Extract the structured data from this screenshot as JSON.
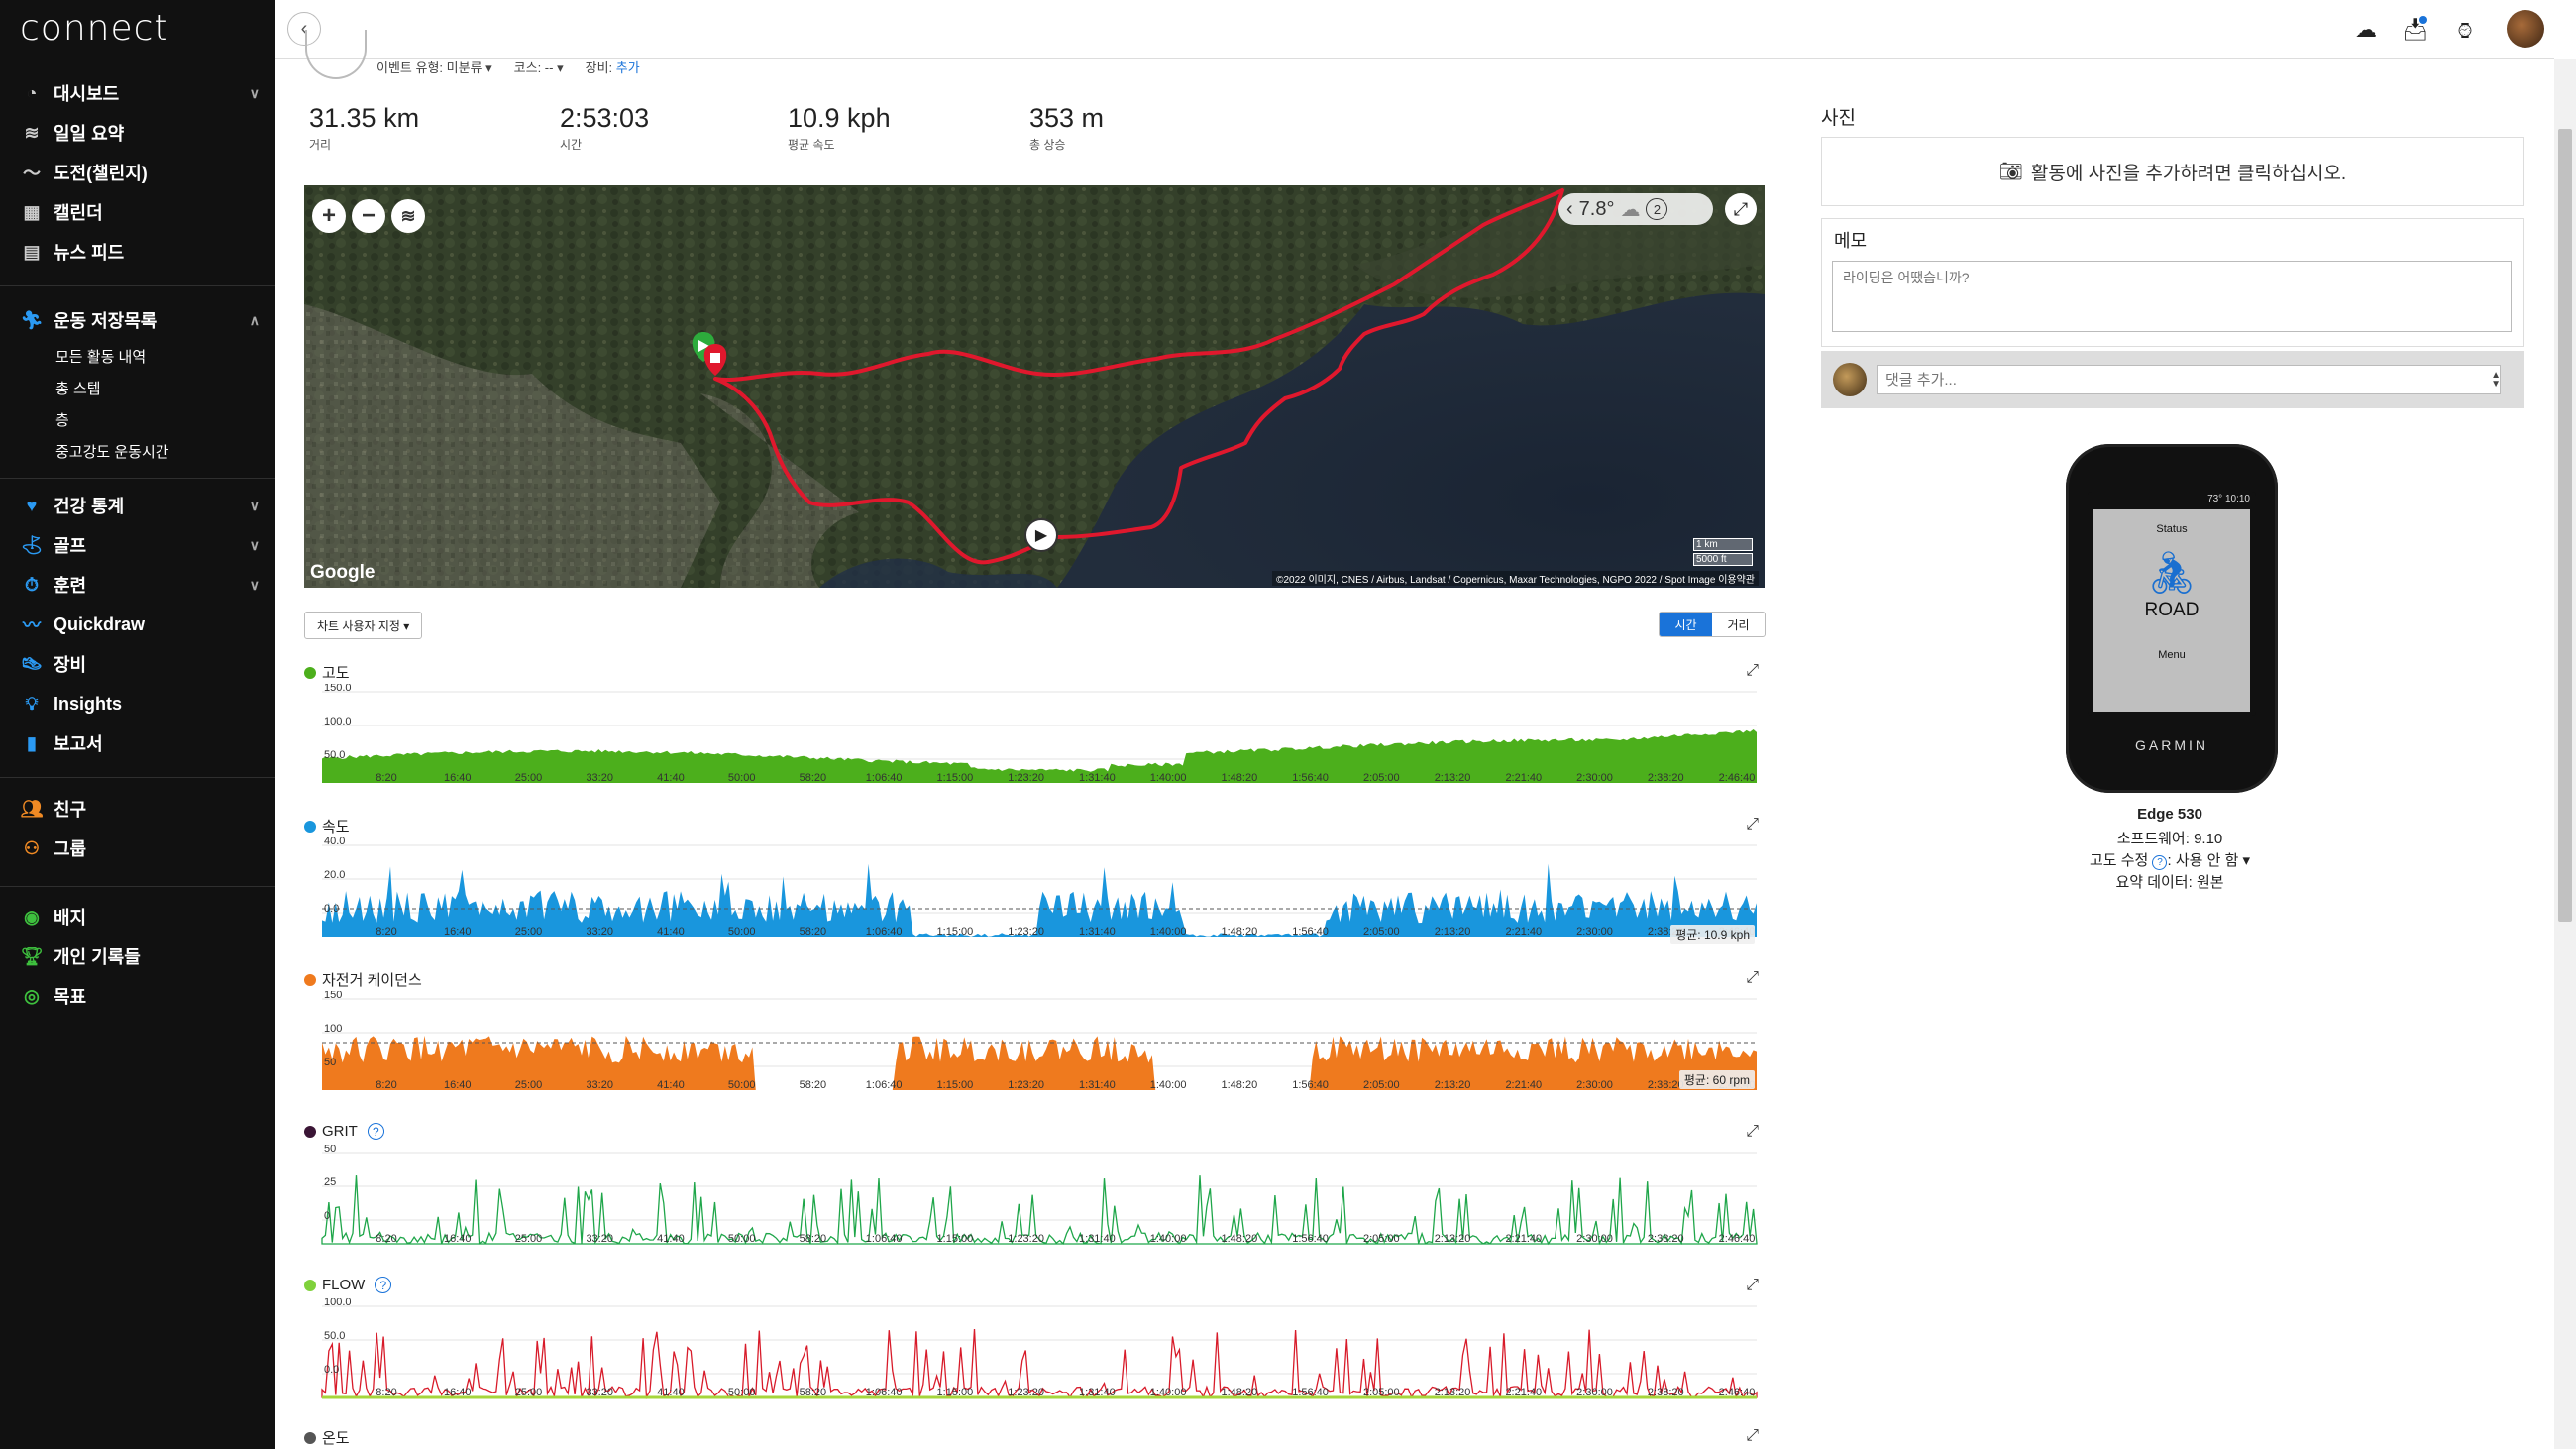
{
  "app": {
    "logo": "connect"
  },
  "sidebar": {
    "main": [
      {
        "label": "대시보드",
        "icon": "dashboard-icon",
        "chevron": "∨"
      },
      {
        "label": "일일 요약",
        "icon": "layers-icon"
      },
      {
        "label": "도전(챌린지)",
        "icon": "challenge-icon"
      },
      {
        "label": "캘린더",
        "icon": "calendar-icon"
      },
      {
        "label": "뉴스 피드",
        "icon": "newsfeed-icon"
      }
    ],
    "activities": {
      "label": "운동 저장목록",
      "icon": "runner-icon",
      "chevron": "∧",
      "sub": [
        "모든 활동 내역",
        "총 스텝",
        "층",
        "중고강도 운동시간"
      ]
    },
    "more": [
      {
        "label": "건강 통계",
        "icon": "heart-icon",
        "chevron": "∨"
      },
      {
        "label": "골프",
        "icon": "golf-icon",
        "chevron": "∨"
      },
      {
        "label": "훈련",
        "icon": "stopwatch-icon",
        "chevron": "∨"
      },
      {
        "label": "Quickdraw",
        "icon": "quickdraw-icon"
      },
      {
        "label": "장비",
        "icon": "shoe-icon"
      },
      {
        "label": "Insights",
        "icon": "bulb-icon"
      },
      {
        "label": "보고서",
        "icon": "report-icon"
      }
    ],
    "social": [
      {
        "label": "친구",
        "icon": "friends-icon"
      },
      {
        "label": "그룹",
        "icon": "group-icon"
      }
    ],
    "achievements": [
      {
        "label": "배지",
        "icon": "badge-icon"
      },
      {
        "label": "개인 기록들",
        "icon": "trophy-icon"
      },
      {
        "label": "목표",
        "icon": "target-icon"
      }
    ]
  },
  "header": {
    "meta": {
      "event_type": "이벤트 유형: 미분류 ▾",
      "course": "코스: -- ▾",
      "gear_prefix": "장비: ",
      "gear_link": "추가"
    }
  },
  "stats": [
    {
      "value": "31.35 km",
      "label": "거리"
    },
    {
      "value": "2:53:03",
      "label": "시간"
    },
    {
      "value": "10.9 kph",
      "label": "평균 속도"
    },
    {
      "value": "353 m",
      "label": "총 상승"
    }
  ],
  "map": {
    "weather_temp": "7.8°",
    "weather_num": "2",
    "google": "Google",
    "attribution": "©2022 이미지, CNES / Airbus, Landsat / Copernicus, Maxar Technologies, NGPO 2022 / Spot Image   이용약관",
    "scale_km": "1 km",
    "scale_ft": "5000 ft"
  },
  "chart_controls": {
    "customize": "차트 사용자 지정 ▾",
    "toggle": [
      "시간",
      "거리"
    ]
  },
  "x_ticks": [
    "8:20",
    "16:40",
    "25:00",
    "33:20",
    "41:40",
    "50:00",
    "58:20",
    "1:06:40",
    "1:15:00",
    "1:23:20",
    "1:31:40",
    "1:40:00",
    "1:48:20",
    "1:56:40",
    "2:05:00",
    "2:13:20",
    "2:21:40",
    "2:30:00",
    "2:38:20",
    "2:46:40"
  ],
  "charts": [
    {
      "key": "elevation",
      "title": "고도",
      "color": "#4caf1c",
      "y_ticks": [
        "150.0",
        "100.0",
        "50.0"
      ],
      "help": false
    },
    {
      "key": "speed",
      "title": "속도",
      "color": "#1996dd",
      "y_ticks": [
        "40.0",
        "20.0",
        "0.0"
      ],
      "avg": "평균: 10.9 kph",
      "help": false
    },
    {
      "key": "cadence",
      "title": "자전거 케이던스",
      "color": "#ef7a1e",
      "y_ticks": [
        "150",
        "100",
        "50"
      ],
      "avg": "평균: 60 rpm",
      "help": false
    },
    {
      "key": "grit",
      "title": "GRIT",
      "color": "#3a1535",
      "y_ticks": [
        "50",
        "25",
        "0"
      ],
      "help": true
    },
    {
      "key": "flow",
      "title": "FLOW",
      "color": "#7fd13b",
      "y_ticks": [
        "100.0",
        "50.0",
        "0.0"
      ],
      "help": true
    },
    {
      "key": "temperature",
      "title": "온도",
      "color": "#555555",
      "y_ticks": [],
      "help": false
    }
  ],
  "right": {
    "photos_title": "사진",
    "photos_prompt": "활동에 사진을 추가하려면 클릭하십시오.",
    "memo_title": "메모",
    "memo_placeholder": "라이딩은 어땠습니까?",
    "comment_placeholder": "댓글 추가..."
  },
  "device": {
    "status_top": "Status",
    "mode": "ROAD",
    "menu": "Menu",
    "brand": "GARMIN",
    "name": "Edge 530",
    "software": "소프트웨어: 9.10",
    "elevation_correction": "고도 수정",
    "elevation_value": "사용 안 함 ▾",
    "summary": "요약 데이터: 원본",
    "time": "73°  10:10"
  },
  "colors": {
    "accent": "#1a73d9",
    "route": "#e0182d",
    "sidebar": "#111111"
  }
}
